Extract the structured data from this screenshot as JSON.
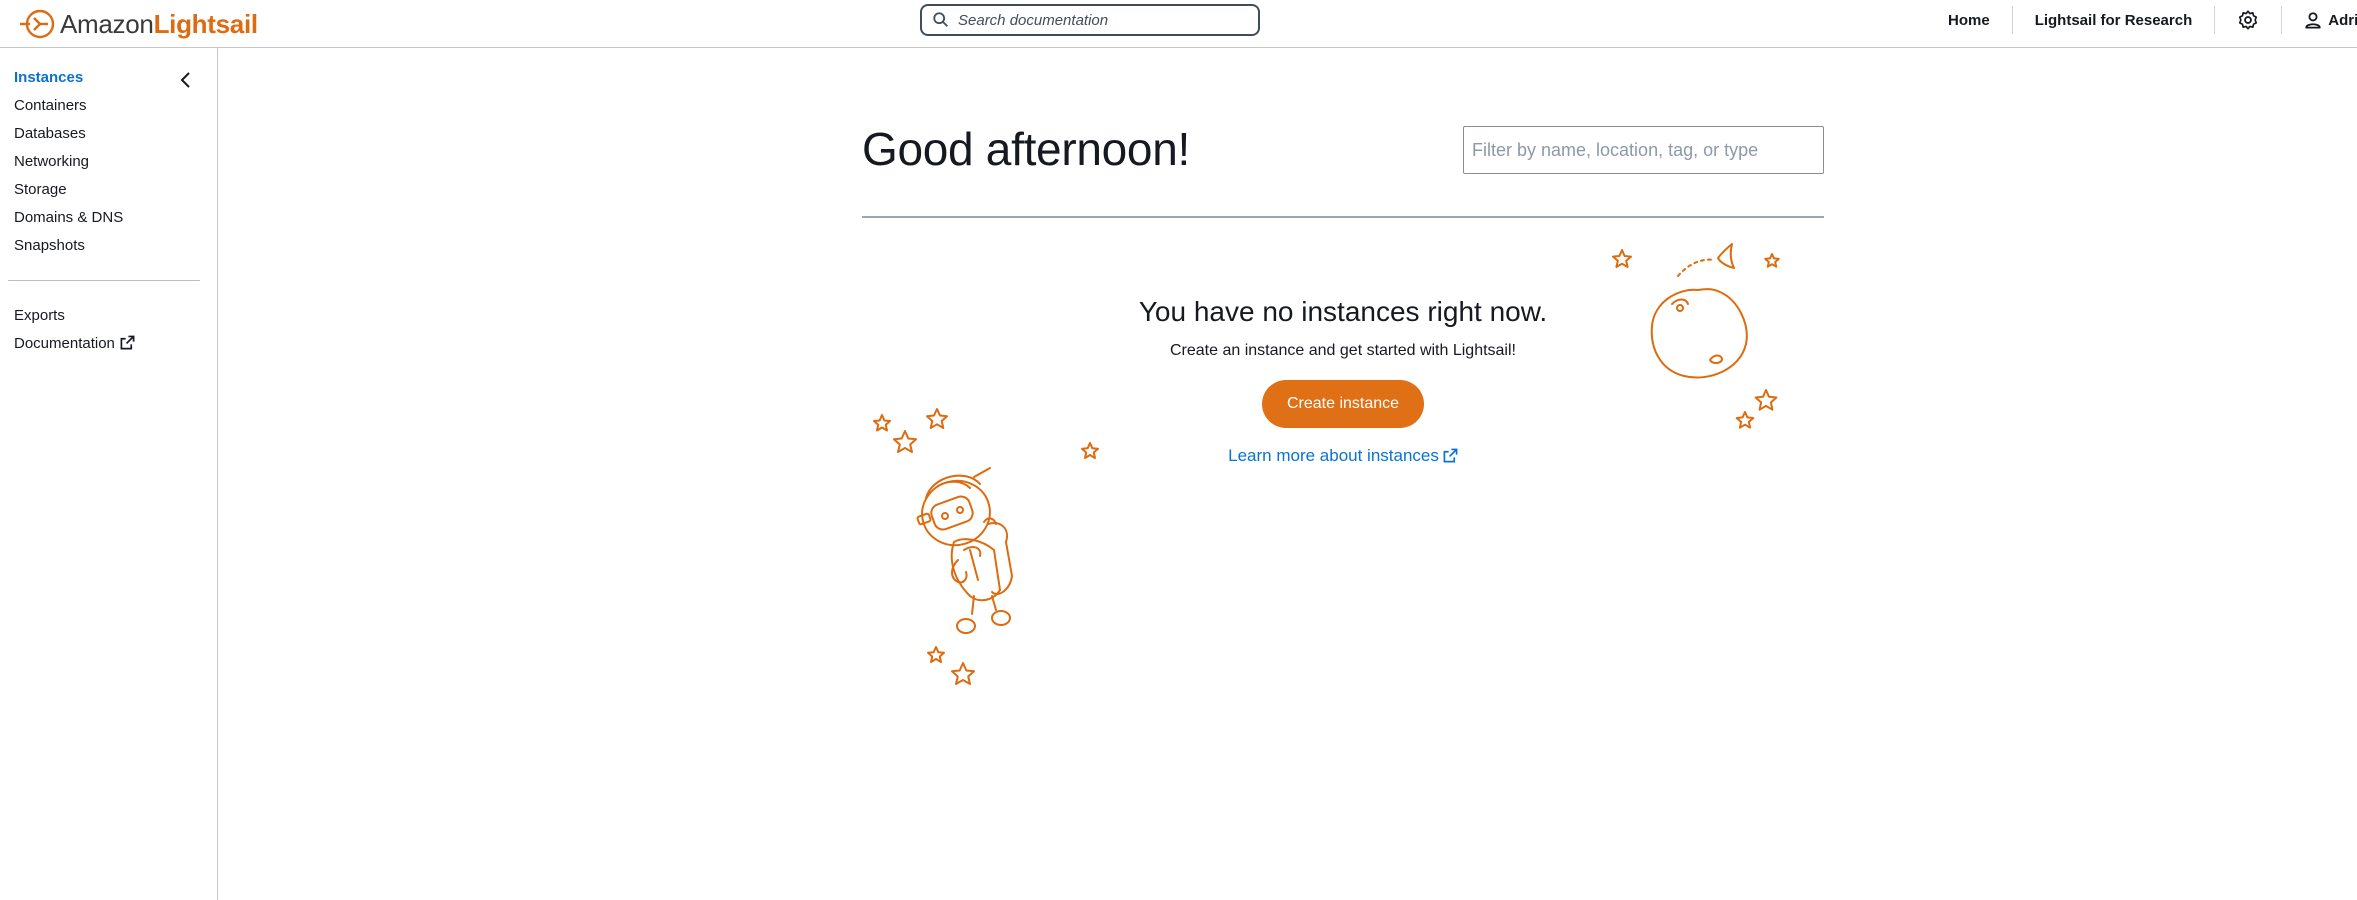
{
  "brand": {
    "name_part1": "Amazon",
    "name_part2": "Lightsail",
    "accent_color": "#dd6b10"
  },
  "header": {
    "search_placeholder": "Search documentation",
    "links": {
      "home": "Home",
      "research": "Lightsail for Research",
      "user": "Adrian"
    },
    "icons": [
      "search-icon",
      "gear-icon",
      "user-icon"
    ]
  },
  "sidebar": {
    "items": [
      {
        "label": "Instances",
        "active": true
      },
      {
        "label": "Containers",
        "active": false
      },
      {
        "label": "Databases",
        "active": false
      },
      {
        "label": "Networking",
        "active": false
      },
      {
        "label": "Storage",
        "active": false
      },
      {
        "label": "Domains & DNS",
        "active": false
      },
      {
        "label": "Snapshots",
        "active": false
      }
    ],
    "secondary": [
      {
        "label": "Exports"
      },
      {
        "label": "Documentation",
        "external": true
      }
    ]
  },
  "main": {
    "greeting": "Good afternoon!",
    "filter_placeholder": "Filter by name, location, tag, or type",
    "empty_state": {
      "title": "You have no instances right now.",
      "subtitle": "Create an instance and get started with Lightsail!",
      "button": "Create instance",
      "link": "Learn more about instances"
    }
  },
  "colors": {
    "primary_button": "#e07015",
    "link": "#0972d3",
    "illustration": "#dd6b10"
  }
}
